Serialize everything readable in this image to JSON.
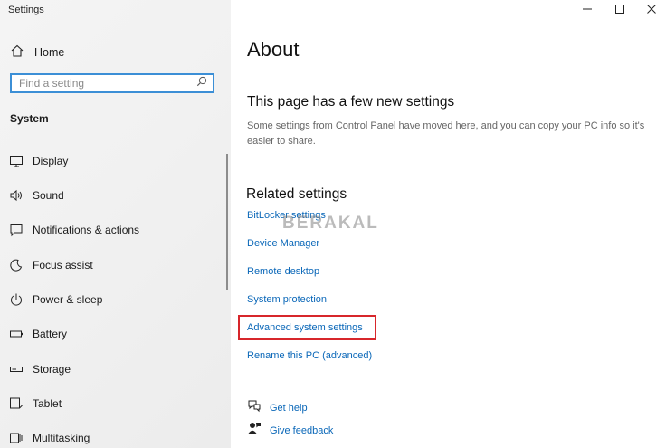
{
  "window": {
    "title": "Settings",
    "controls": [
      "minimize",
      "maximize",
      "close"
    ]
  },
  "sidebar": {
    "home_label": "Home",
    "search_placeholder": "Find a setting",
    "section_header": "System",
    "items": [
      {
        "label": "Display",
        "icon": "display-icon"
      },
      {
        "label": "Sound",
        "icon": "sound-icon"
      },
      {
        "label": "Notifications & actions",
        "icon": "notifications-icon"
      },
      {
        "label": "Focus assist",
        "icon": "focus-assist-icon"
      },
      {
        "label": "Power & sleep",
        "icon": "power-icon"
      },
      {
        "label": "Battery",
        "icon": "battery-icon"
      },
      {
        "label": "Storage",
        "icon": "storage-icon"
      },
      {
        "label": "Tablet",
        "icon": "tablet-icon"
      },
      {
        "label": "Multitasking",
        "icon": "multitasking-icon"
      }
    ]
  },
  "main": {
    "title": "About",
    "new_settings_heading": "This page has a few new settings",
    "new_settings_desc": "Some settings from Control Panel have moved here, and you can copy your PC info so it's easier to share.",
    "related_heading": "Related settings",
    "related_links": [
      "BitLocker settings",
      "Device Manager",
      "Remote desktop",
      "System protection",
      "Advanced system settings",
      "Rename this PC (advanced)"
    ],
    "help_links": [
      "Get help",
      "Give feedback"
    ],
    "watermark": "BERAKAL"
  },
  "colors": {
    "accent": "#0a67b8",
    "search_border": "#3c8fd6",
    "highlight_box": "#d7262b"
  }
}
